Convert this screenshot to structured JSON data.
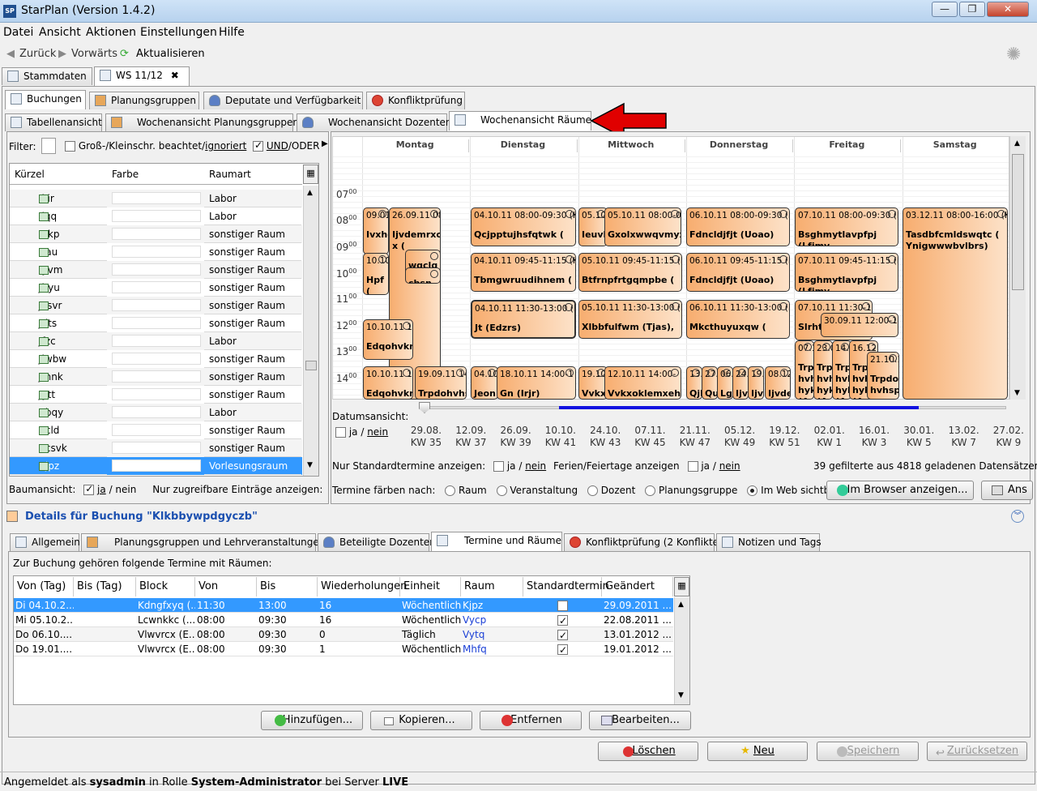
{
  "app": {
    "title": "StarPlan (Version 1.4.2)",
    "icon": "SP"
  },
  "window_buttons": {
    "minimize": "—",
    "restore": "❐",
    "close": "✕"
  },
  "menu": [
    "Datei",
    "Ansicht",
    "Aktionen",
    "Einstellungen",
    "Hilfe"
  ],
  "toolbar": {
    "back": "Zurück",
    "forward": "Vorwärts",
    "refresh": "Aktualisieren"
  },
  "main_tabs": [
    "Stammdaten",
    "WS 11/12"
  ],
  "sub_tabs": [
    "Buchungen",
    "Planungsgruppen",
    "Deputate und Verfügbarkeit",
    "Konfliktprüfung"
  ],
  "view_tabs": [
    "Tabellenansicht",
    "Wochenansicht Planungsgruppen",
    "Wochenansicht Dozenten",
    "Wochenansicht Räume"
  ],
  "filter": {
    "label": "Filter:",
    "case_label": "Groß-/Kleinschr. beachtet/",
    "case_link": "ignoriert",
    "and_label": "UND",
    "or_label": "/ODER"
  },
  "room_table": {
    "headers": [
      "Kürzel",
      "Farbe",
      "Raumart"
    ],
    "rows": [
      {
        "code": "Ikir",
        "type": "Labor"
      },
      {
        "code": "Ilqq",
        "type": "Labor"
      },
      {
        "code": "Iokp",
        "type": "sonstiger Raum"
      },
      {
        "code": "Itau",
        "type": "sonstiger Raum"
      },
      {
        "code": "Iyvm",
        "type": "sonstiger Raum"
      },
      {
        "code": "Jbyu",
        "type": "sonstiger Raum"
      },
      {
        "code": "Jcsvr",
        "type": "sonstiger Raum"
      },
      {
        "code": "Jdts",
        "type": "sonstiger Raum"
      },
      {
        "code": "Jfzc",
        "type": "Labor"
      },
      {
        "code": "Jiwbw",
        "type": "sonstiger Raum"
      },
      {
        "code": "Jmnk",
        "type": "sonstiger Raum"
      },
      {
        "code": "Jytt",
        "type": "sonstiger Raum"
      },
      {
        "code": "Kbqy",
        "type": "Labor"
      },
      {
        "code": "Kcld",
        "type": "sonstiger Raum"
      },
      {
        "code": "Kcsvk",
        "type": "sonstiger Raum"
      },
      {
        "code": "Kjpz",
        "type": "Vorlesungsraum"
      }
    ]
  },
  "tree": {
    "label": "Baumansicht:",
    "ja": "ja",
    "nein": "/ nein",
    "access_label": "Nur zugreifbare Einträge anzeigen:"
  },
  "days": [
    "Montag",
    "Dienstag",
    "Mittwoch",
    "Donnerstag",
    "Freitag",
    "Samstag"
  ],
  "hours": [
    "07",
    "08",
    "09",
    "10",
    "11",
    "12",
    "13",
    "14"
  ],
  "minute_sup": "00",
  "events": [
    {
      "t": "09.01.",
      "b": "Ivxhg"
    },
    {
      "t": "26.09.11 08:",
      "b": "Ijvdemrxcf x ("
    },
    {
      "t": "",
      "b": "wgclg"
    },
    {
      "t": "10.10.11 0",
      "b": "Hpf ("
    },
    {
      "t": "",
      "b": "cbsn"
    },
    {
      "t": "10.10.11 1",
      "b": "Edqohvkn"
    },
    {
      "t": "10.10.11 1",
      "b": "Edqohvkn"
    },
    {
      "t": "19.09.11 14:",
      "b": "Trpdohvhs"
    },
    {
      "t": "04.10.11 08:00-09:30 (Kjp",
      "b": "Qcjpptujhsfqtwk ("
    },
    {
      "t": "04.10.11 09:45-11:15 (Kjp",
      "b": "Tbmgwruudihnem ("
    },
    {
      "t": "04.10.11 11:30-13:00 (Kjp",
      "b": "Jt (Edzrs)"
    },
    {
      "t": "04.10",
      "b": "Jeon"
    },
    {
      "t": "18.10.11 14:00-1",
      "b": "Gn (Irjr)"
    },
    {
      "t": "05.10.",
      "b": "Ieuvk"
    },
    {
      "t": "05.10.11 08:00-09:",
      "b": "Gxolxwwqvmyx"
    },
    {
      "t": "05.10.11 09:45-11:15 (Kjp",
      "b": "Btfrnpfrtgqmpbe ("
    },
    {
      "t": "05.10.11 11:30-13:00 (Kjp",
      "b": "Xlbbfulfwm (Tjas),"
    },
    {
      "t": "19.10",
      "b": "Vvkxc"
    },
    {
      "t": "12.10.11 14:00-",
      "b": "Vvkxoklemxehv"
    },
    {
      "t": "06.10.11 08:00-09:30 (Kjp",
      "b": "Fdncldjfjt (Uoao)"
    },
    {
      "t": "06.10.11 09:45-11:15 (Kjp",
      "b": "Fdncldjfjt (Uoao)"
    },
    {
      "t": "06.10.11 11:30-13:00 (Kjp",
      "b": "Mkcthuyuxqw ("
    },
    {
      "t": "13.",
      "b": "Qjb"
    },
    {
      "t": "27.",
      "b": "Qu"
    },
    {
      "t": "06.",
      "b": "Lg"
    },
    {
      "t": "24.",
      "b": "Ijv"
    },
    {
      "t": "19.",
      "b": "Ijv"
    },
    {
      "t": "08.12",
      "b": "Ijvde"
    },
    {
      "t": "07.10.11 08:00-09:30 (Kjp",
      "b": "Bsghmytlavpfpj (Lfjmv"
    },
    {
      "t": "07.10.11 09:45-11:15 (Kjp",
      "b": "Bsghmytlavpfpj (Lfjmv"
    },
    {
      "t": "07.10.11 11:30-1",
      "b": "Slrht"
    },
    {
      "t": "30.09.11 12:00-13:",
      "b": "(Uoao)"
    },
    {
      "t": "07.1",
      "b": "Trp hvh hyk (Ae"
    },
    {
      "t": "23.0",
      "b": "Trp hvh hyk (Ae"
    },
    {
      "t": "14.1",
      "b": "Trp hvh hyk (Ae"
    },
    {
      "t": "16.12.1",
      "b": "Trp hvh hyk (Ae"
    },
    {
      "t": "21.10.1",
      "b": "Trpdo hvhsp"
    },
    {
      "t": "03.12.11 08:00-16:00 (Kjp",
      "b": "Tasdbfcmldswqtc ( Ynigwwwbvlbrs)"
    }
  ],
  "date_view": {
    "label": "Datumsansicht:",
    "ja": "ja",
    "nein": "nein",
    "ticks": [
      {
        "d": "29.08.",
        "w": "KW 35"
      },
      {
        "d": "12.09.",
        "w": "KW 37"
      },
      {
        "d": "26.09.",
        "w": "KW 39"
      },
      {
        "d": "10.10.",
        "w": "KW 41"
      },
      {
        "d": "24.10.",
        "w": "KW 43"
      },
      {
        "d": "07.11.",
        "w": "KW 45"
      },
      {
        "d": "21.11.",
        "w": "KW 47"
      },
      {
        "d": "05.12.",
        "w": "KW 49"
      },
      {
        "d": "19.12.",
        "w": "KW 51"
      },
      {
        "d": "02.01.",
        "w": "KW 1"
      },
      {
        "d": "16.01.",
        "w": "KW 3"
      },
      {
        "d": "30.01.",
        "w": "KW 5"
      },
      {
        "d": "13.02.",
        "w": "KW 7"
      },
      {
        "d": "27.02.",
        "w": "KW 9"
      }
    ]
  },
  "std_only": {
    "label": "Nur Standardtermine anzeigen:",
    "ja": "ja",
    "nein": "nein"
  },
  "holidays": {
    "label": "Ferien/Feiertage anzeigen",
    "ja": "ja",
    "nein": "nein"
  },
  "records": "39 gefilterte aus 4818 geladenen Datensätzen",
  "color_by": {
    "label": "Termine färben nach:",
    "options": [
      "Raum",
      "Veranstaltung",
      "Dozent",
      "Planungsgruppe",
      "Im Web sichtbar"
    ]
  },
  "browser_btn": "Im Browser anzeigen...",
  "ans_btn": "Ans",
  "details": {
    "title": "Details für Buchung \"Klkbbywpdgyczb\"",
    "tabs": [
      "Allgemein",
      "Planungsgruppen und Lehrveranstaltungen",
      "Beteiligte Dozenten",
      "Termine und Räume",
      "Konfliktprüfung (2 Konflikte)",
      "Notizen und Tags"
    ],
    "intro": "Zur Buchung gehören folgende Termine mit Räumen:",
    "headers": [
      "Von (Tag)",
      "Bis (Tag)",
      "Block",
      "Von",
      "Bis",
      "Wiederholungen",
      "Einheit",
      "Raum",
      "Standardtermin",
      "Geändert am"
    ],
    "rows": [
      [
        "Di 04.10.2...",
        "",
        "Kdngfxyq (...",
        "11:30",
        "13:00",
        "16",
        "Wöchentlich",
        "Kjpz",
        "",
        "29.09.2011 ..."
      ],
      [
        "Mi 05.10.2...",
        "",
        "Lcwnkkc (...",
        "08:00",
        "09:30",
        "16",
        "Wöchentlich",
        "Vycp",
        "",
        "22.08.2011 ..."
      ],
      [
        "Do 06.10....",
        "",
        "Vlwvrcx (E...",
        "08:00",
        "09:30",
        "0",
        "Täglich",
        "Vytq",
        "",
        "13.01.2012 ..."
      ],
      [
        "Do 19.01....",
        "",
        "Vlwvrcx (E...",
        "08:00",
        "09:30",
        "1",
        "Wöchentlich",
        "Mhfq",
        "",
        "19.01.2012 ..."
      ]
    ],
    "buttons": [
      "Hinzufügen...",
      "Kopieren...",
      "Entfernen",
      "Bearbeiten..."
    ]
  },
  "footer_buttons": [
    "Löschen",
    "Neu",
    "Speichern",
    "Zurücksetzen"
  ],
  "status": {
    "pre": "Angemeldet als ",
    "user": "sysadmin",
    "mid": " in Rolle ",
    "role": "System-Administrator",
    "mid2": " bei Server ",
    "server": "LIVE"
  },
  "colors": {
    "event": "#f7ad6f",
    "selection": "#3399ff",
    "arrow": "#e00000",
    "timeline": "#1010e0"
  }
}
